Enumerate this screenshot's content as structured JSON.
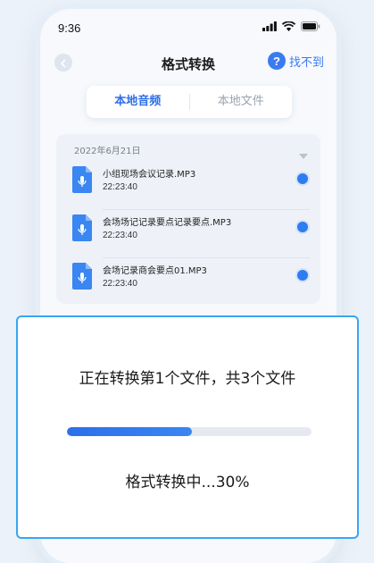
{
  "status_bar": {
    "time": "9:36"
  },
  "nav": {
    "title": "格式转换",
    "help_label": "找不到",
    "help_icon": "?"
  },
  "tabs": [
    {
      "label": "本地音频",
      "active": true
    },
    {
      "label": "本地文件",
      "active": false
    }
  ],
  "file_list": {
    "date": "2022年6月21日",
    "items": [
      {
        "name": "小组现场会议记录.MP3",
        "time": "22:23:40",
        "selected": true
      },
      {
        "name": "会场场记记录要点记录要点.MP3",
        "time": "22:23:40",
        "selected": true
      },
      {
        "name": "会场记录商会要点01.MP3",
        "time": "22:23:40",
        "selected": true
      }
    ]
  },
  "dialog": {
    "message": "正在转换第1个文件，共3个文件",
    "progress_fraction": 0.51,
    "progress_label": "格式转换中...30%"
  },
  "colors": {
    "accent": "#2f6fe8",
    "dialog_border": "#38a6f3",
    "file_icon": "#3a86f2"
  }
}
